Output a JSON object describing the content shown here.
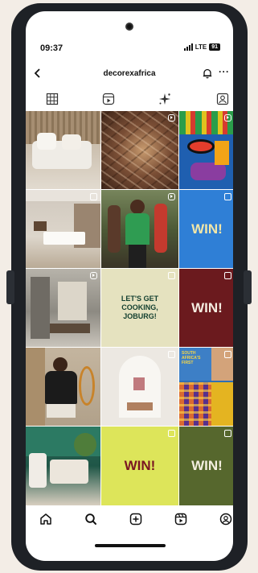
{
  "status_bar": {
    "time": "09:37",
    "network": "LTE",
    "battery": "91"
  },
  "profile_header": {
    "username": "decorexafrica"
  },
  "profile_tabs": [
    "grid",
    "reels",
    "ai-effects",
    "tagged"
  ],
  "posts": [
    {
      "kind": "photo",
      "scene": "sofa",
      "text": ""
    },
    {
      "kind": "reel",
      "scene": "glass",
      "text": ""
    },
    {
      "kind": "reel",
      "scene": "mural",
      "text": ""
    },
    {
      "kind": "photo",
      "scene": "bedroom",
      "text": ""
    },
    {
      "kind": "reel",
      "scene": "event",
      "text": ""
    },
    {
      "kind": "text",
      "scene": "blue",
      "text": "WIN!"
    },
    {
      "kind": "reel",
      "scene": "interior",
      "text": ""
    },
    {
      "kind": "text",
      "scene": "cream",
      "text": "LET'S GET COOKING, JOBURG!"
    },
    {
      "kind": "text",
      "scene": "maroon",
      "text": "WIN!"
    },
    {
      "kind": "photo",
      "scene": "person",
      "text": ""
    },
    {
      "kind": "photo",
      "scene": "arch",
      "text": ""
    },
    {
      "kind": "text",
      "scene": "poster",
      "text": "SOUTH AFRICA'S FIRST"
    },
    {
      "kind": "photo",
      "scene": "greenroom",
      "text": ""
    },
    {
      "kind": "text",
      "scene": "lime",
      "text": "WIN!"
    },
    {
      "kind": "text",
      "scene": "olive",
      "text": "WIN!"
    }
  ],
  "bottom_nav": [
    "home",
    "search",
    "create",
    "reels",
    "profile"
  ],
  "colors": {
    "accent_blue": "#2f7fd6",
    "maroon": "#6b1a1e",
    "lime": "#dde55a",
    "olive": "#56672d",
    "cream": "#e5e2bf"
  }
}
